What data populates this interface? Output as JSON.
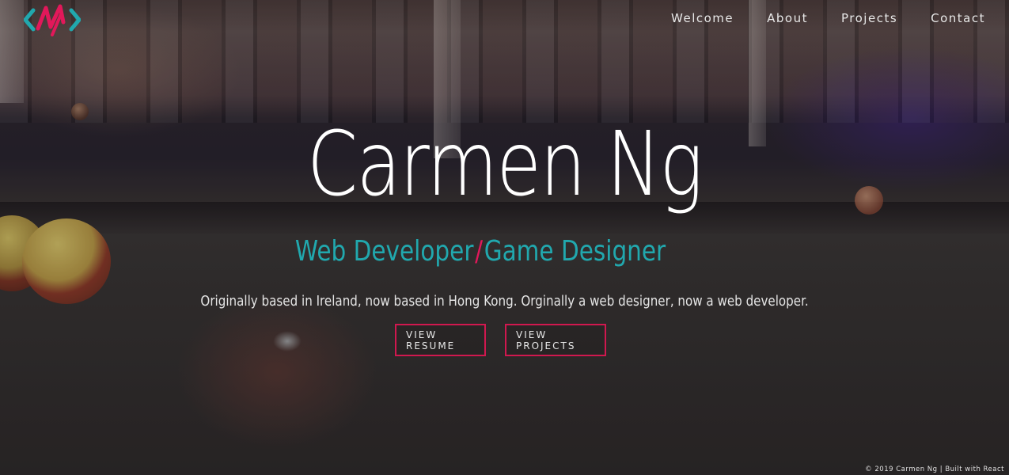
{
  "brand": {
    "logo_icon": "mn-monogram-logo-icon",
    "colors": {
      "teal": "#21a8ae",
      "pink": "#e2185a",
      "button_border": "#d0184f"
    }
  },
  "nav": {
    "items": [
      {
        "label": "Welcome"
      },
      {
        "label": "About"
      },
      {
        "label": "Projects"
      },
      {
        "label": "Contact"
      }
    ]
  },
  "hero": {
    "name": "Carmen Ng",
    "roles": [
      "Web Developer",
      "Game Designer"
    ],
    "separator": "/",
    "tagline": "Originally based in Ireland, now based in Hong Kong. Orginally a web designer, now a web developer.",
    "buttons": {
      "resume": "VIEW RESUME",
      "projects": "VIEW PROJECTS"
    }
  },
  "footer": {
    "text": "© 2019 Carmen Ng | Built with React"
  }
}
